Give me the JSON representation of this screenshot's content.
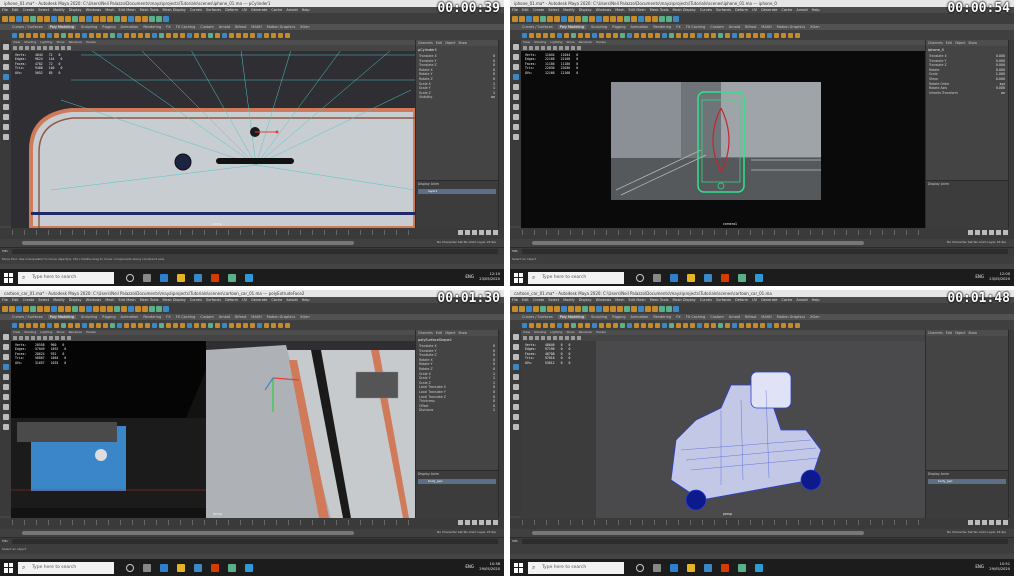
{
  "panes": [
    {
      "id": "pane-0",
      "title": "iphone_01.ma* - Autodesk Maya 2020: C:\\Users\\Neil Palazzo\\Documents\\maya\\projects\\Tutorials\\scenes\\iphone_01.ma --- pCylinder1",
      "timestamp": "00:00:39",
      "shelf_active_tab": "Poly Modeling",
      "hud": [
        [
          "Verts:",
          "4844",
          "72",
          "0"
        ],
        [
          "Edges:",
          "9624",
          "144",
          "0"
        ],
        [
          "Faces:",
          "4782",
          "72",
          "0"
        ],
        [
          "Tris:",
          "9488",
          "140",
          "0"
        ],
        [
          "UVs:",
          "5052",
          "85",
          "0"
        ]
      ],
      "channel_title": "pCylinder1",
      "channel_attrs": [
        [
          "Translate X",
          "0"
        ],
        [
          "Translate Y",
          "0"
        ],
        [
          "Translate Z",
          "0"
        ],
        [
          "Rotate X",
          "0"
        ],
        [
          "Rotate Y",
          "0"
        ],
        [
          "Rotate Z",
          "0"
        ],
        [
          "Scale X",
          "1"
        ],
        [
          "Scale Y",
          "1"
        ],
        [
          "Scale Z",
          "1"
        ],
        [
          "Visibility",
          "on"
        ]
      ],
      "layer_row": "layer1",
      "camera_label": "persp",
      "help_text": "Move Tool: Use manipulator to move object(s). Ctrl+middle-drag to move components along constraint axis.",
      "taskbar_time": "12:10",
      "taskbar_date": "23/05/2020"
    },
    {
      "id": "pane-1",
      "title": "iphone_01.ma* - Autodesk Maya 2020: C:\\Users\\Neil Palazzo\\Documents\\maya\\projects\\Tutorials\\scenes\\iphone_01.ma --- iphone_0",
      "timestamp": "00:00:54",
      "shelf_active_tab": "Poly Modeling",
      "hud": [
        [
          "Verts:",
          "11044",
          "11044",
          "0"
        ],
        [
          "Edges:",
          "22168",
          "22168",
          "0"
        ],
        [
          "Faces:",
          "11186",
          "11186",
          "0"
        ],
        [
          "Tris:",
          "22036",
          "22036",
          "0"
        ],
        [
          "UVs:",
          "12168",
          "12168",
          "0"
        ]
      ],
      "channel_title": "iphone_0",
      "channel_attrs": [
        [
          "Translate X",
          "0.000"
        ],
        [
          "Translate Y",
          "0.000"
        ],
        [
          "Translate Z",
          "0.000"
        ],
        [
          "Rotate",
          "0.000"
        ],
        [
          "Scale",
          "1.000"
        ],
        [
          "Shear",
          "0.000"
        ],
        [
          "Rotate Order",
          "xyz"
        ],
        [
          "Rotate Axis",
          "0.000"
        ],
        [
          "Inherits Transform",
          "on"
        ]
      ],
      "layer_row": "",
      "camera_label": "camera1",
      "help_text": "Select an object",
      "taskbar_time": "12:00",
      "taskbar_date": "23/05/2020"
    },
    {
      "id": "pane-2",
      "title": "cartoon_car_01.ma* - Autodesk Maya 2020: C:\\Users\\Neil Palazzo\\Documents\\maya\\projects\\Tutorials\\scenes\\cartoon_car_01.ma --- polyExtrudeFace2",
      "timestamp": "00:01:30",
      "shelf_active_tab": "Poly Modeling",
      "hud": [
        [
          "Verts:",
          "28558",
          "960",
          "0"
        ],
        [
          "Edges:",
          "57049",
          "1892",
          "0"
        ],
        [
          "Faces:",
          "28624",
          "932",
          "0"
        ],
        [
          "Tris:",
          "56867",
          "1864",
          "0"
        ],
        [
          "UVs:",
          "31657",
          "1035",
          "0"
        ]
      ],
      "channel_title": "polySurfaceShape1",
      "channel_attrs": [
        [
          "Translate X",
          "0"
        ],
        [
          "Translate Y",
          "0"
        ],
        [
          "Translate Z",
          "0"
        ],
        [
          "Rotate X",
          "0"
        ],
        [
          "Rotate Y",
          "0"
        ],
        [
          "Rotate Z",
          "0"
        ],
        [
          "Scale X",
          "1"
        ],
        [
          "Scale Y",
          "1"
        ],
        [
          "Scale Z",
          "1"
        ],
        [
          "Local Translate X",
          "0"
        ],
        [
          "Local Translate Y",
          "0"
        ],
        [
          "Local Translate Z",
          "0"
        ],
        [
          "Thickness",
          "0"
        ],
        [
          "Offset",
          "0"
        ],
        [
          "Divisions",
          "1"
        ]
      ],
      "layer_row": "body_geo",
      "camera_label": "persp",
      "help_text": "Select an object",
      "taskbar_time": "10:36",
      "taskbar_date": "29/05/2020"
    },
    {
      "id": "pane-3",
      "title": "cartoon_car_01.ma* - Autodesk Maya 2020: C:\\Users\\Neil Palazzo\\Documents\\maya\\projects\\Tutorials\\scenes\\cartoon_car_01.ma",
      "timestamp": "00:01:48",
      "shelf_active_tab": "Poly Modeling",
      "hud": [
        [
          "Verts:",
          "48640",
          "0",
          "0"
        ],
        [
          "Edges:",
          "97196",
          "0",
          "0"
        ],
        [
          "Faces:",
          "48708",
          "0",
          "0"
        ],
        [
          "Tris:",
          "97016",
          "0",
          "0"
        ],
        [
          "UVs:",
          "53612",
          "0",
          "0"
        ]
      ],
      "channel_title": "",
      "channel_attrs": [],
      "layer_row": "body_geo",
      "camera_label": "persp",
      "help_text": "",
      "taskbar_time": "10:51",
      "taskbar_date": "29/05/2020"
    }
  ],
  "menus": [
    "File",
    "Edit",
    "Create",
    "Select",
    "Modify",
    "Display",
    "Windows",
    "Mesh",
    "Edit Mesh",
    "Mesh Tools",
    "Mesh Display",
    "Curves",
    "Surfaces",
    "Deform",
    "UV",
    "Generate",
    "Cache",
    "Arnold",
    "Help"
  ],
  "shelf_tabs": [
    "Curves / Surfaces",
    "Poly Modeling",
    "Sculpting",
    "Rigging",
    "Animation",
    "Rendering",
    "FX",
    "FX Caching",
    "Custom",
    "Arnold",
    "Bifrost",
    "MASH",
    "Motion Graphics",
    "XGen"
  ],
  "viewport_menu": [
    "View",
    "Shading",
    "Lighting",
    "Show",
    "Renderer",
    "Panels"
  ],
  "channel_menu": [
    "Channels",
    "Edit",
    "Object",
    "Show"
  ],
  "layer_tabs": "Display  Anim",
  "taskbar_search": "Type here to search",
  "taskbar_lang": "ENG",
  "mel_label": "MEL",
  "range_text": "No Character Set  No Anim Layer  24 fps",
  "accent_colors": {
    "orange": "#c58a2a",
    "blue": "#3a88c5",
    "teal": "#5bb08a"
  }
}
